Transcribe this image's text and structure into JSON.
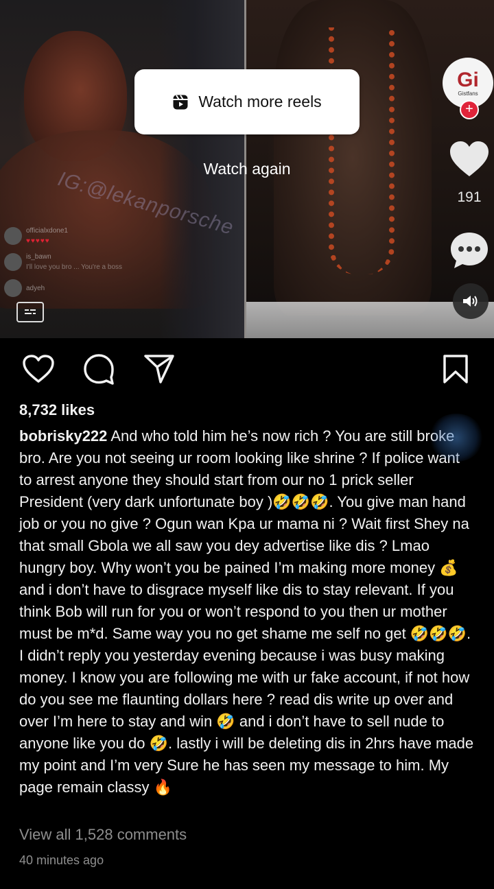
{
  "reel": {
    "watch_more_label": "Watch more reels",
    "watch_again_label": "Watch again",
    "watermark_text": "IG:@lekanporsche",
    "live_comments": [
      {
        "name": "officialxdone1",
        "text": "♥♥♥♥♥"
      },
      {
        "name": "is_bawn",
        "text": "I'll love you bro ... You're a boss"
      },
      {
        "name": "adyeh",
        "text": ""
      }
    ],
    "creator_badge": "Gi",
    "creator_badge_sub": "Gistfans",
    "like_count": "191",
    "sound_state": "on"
  },
  "actions": {
    "like_icon": "heart-outline-icon",
    "comment_icon": "comment-bubble-icon",
    "share_icon": "paper-plane-icon",
    "save_icon": "bookmark-icon"
  },
  "post": {
    "likes": "8,732 likes",
    "username": "bobrisky222",
    "caption": "And who told him he’s now rich ? You are still broke bro. Are you not seeing ur room looking like shrine ? If police want to arrest anyone they should start from our no 1 prick seller President (very dark unfortunate boy )🤣🤣🤣. You give man hand job or you no give ? Ogun wan Kpa ur mama ni ? Wait first Shey na that small Gbola we all saw you dey advertise like dis ? Lmao hungry boy. Why won’t you be pained I’m making more money 💰 and i don’t have to disgrace myself like dis to stay relevant. If you think Bob will run for you or won’t respond to you then ur mother must be m*d. Same way you no get shame me self no get 🤣🤣🤣. I didn’t reply you yesterday evening because i was busy making money. I know you are following me with ur fake account, if not how do you see me flaunting dollars here ? read dis write up over and over I’m here to stay and win 🤣 and i don’t have to sell nude to anyone like you do 🤣. lastly i will be deleting dis in 2hrs have made my point and I’m very  Sure he has seen my message to him. My page remain classy 🔥",
    "view_comments": "View all 1,528 comments",
    "timestamp": "40 minutes ago"
  },
  "colors": {
    "background": "#000000",
    "text": "#f2f2f2",
    "muted": "#8e8e8e",
    "badge_red": "#e0243a"
  }
}
